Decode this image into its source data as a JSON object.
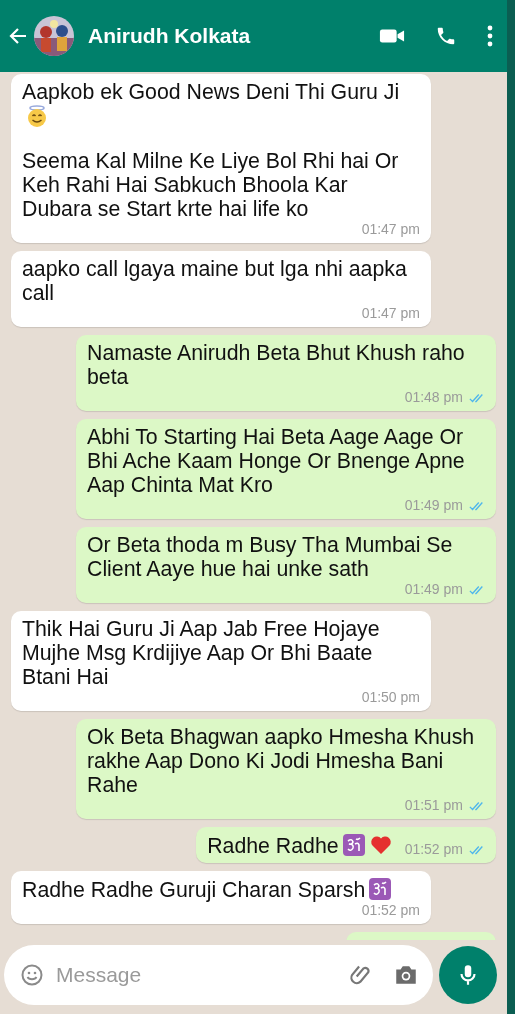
{
  "header": {
    "contact_name": "Anirudh Kolkata"
  },
  "messages": [
    {
      "kind": "incoming",
      "paragraphs": [
        {
          "text": "Aapkob ek Good News Deni Thi Guru Ji",
          "emoji": [
            {
              "kind": "halo"
            }
          ]
        },
        {
          "text": "Seema Kal Milne Ke Liye Bol Rhi hai Or Keh Rahi Hai Sabkuch Bhoola Kar Dubara se Start krte hai life ko"
        }
      ],
      "time": "01:47 pm"
    },
    {
      "kind": "incoming",
      "paragraphs": [
        {
          "text": "aapko call lgaya maine but lga nhi aapka call"
        }
      ],
      "time": "01:47 pm"
    },
    {
      "kind": "outgoing",
      "paragraphs": [
        {
          "text": "Namaste Anirudh Beta Bhut Khush raho beta"
        }
      ],
      "time": "01:48 pm",
      "read": true
    },
    {
      "kind": "outgoing",
      "paragraphs": [
        {
          "text": "Abhi To Starting Hai Beta Aage Aage Or Bhi Ache Kaam Honge Or Bnenge Apne Aap Chinta Mat Kro"
        }
      ],
      "time": "01:49 pm",
      "read": true
    },
    {
      "kind": "outgoing",
      "paragraphs": [
        {
          "text": "Or Beta thoda m Busy Tha Mumbai Se Client Aaye hue hai unke sath"
        }
      ],
      "time": "01:49 pm",
      "read": true
    },
    {
      "kind": "incoming",
      "paragraphs": [
        {
          "text": "Thik Hai Guru Ji Aap Jab Free Hojaye Mujhe Msg Krdijiye Aap Or Bhi Baate Btani Hai"
        }
      ],
      "time": "01:50 pm"
    },
    {
      "kind": "outgoing",
      "paragraphs": [
        {
          "text": "Ok Beta Bhagwan aapko Hmesha Khush rakhe Aap Dono Ki Jodi Hmesha Bani Rahe"
        }
      ],
      "time": "01:51 pm",
      "read": true
    },
    {
      "kind": "outgoing",
      "paragraphs": [
        {
          "text": "Radhe Radhe",
          "emoji": [
            {
              "kind": "om"
            },
            {
              "kind": "heart"
            }
          ]
        }
      ],
      "time": "01:52 pm",
      "read": true
    },
    {
      "kind": "incoming",
      "paragraphs": [
        {
          "text": "Radhe Radhe Guruji Charan Sparsh",
          "emoji": [
            {
              "kind": "om"
            }
          ]
        }
      ],
      "time": "01:52 pm"
    },
    {
      "kind": "outgoing-partial"
    }
  ],
  "composer": {
    "placeholder": "Message"
  }
}
